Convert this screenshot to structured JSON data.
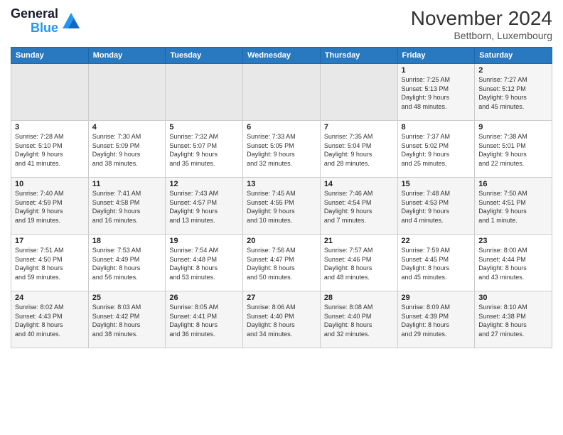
{
  "logo": {
    "line1": "General",
    "line2": "Blue"
  },
  "title": "November 2024",
  "location": "Bettborn, Luxembourg",
  "weekdays": [
    "Sunday",
    "Monday",
    "Tuesday",
    "Wednesday",
    "Thursday",
    "Friday",
    "Saturday"
  ],
  "weeks": [
    [
      {
        "day": "",
        "info": ""
      },
      {
        "day": "",
        "info": ""
      },
      {
        "day": "",
        "info": ""
      },
      {
        "day": "",
        "info": ""
      },
      {
        "day": "",
        "info": ""
      },
      {
        "day": "1",
        "info": "Sunrise: 7:25 AM\nSunset: 5:13 PM\nDaylight: 9 hours\nand 48 minutes."
      },
      {
        "day": "2",
        "info": "Sunrise: 7:27 AM\nSunset: 5:12 PM\nDaylight: 9 hours\nand 45 minutes."
      }
    ],
    [
      {
        "day": "3",
        "info": "Sunrise: 7:28 AM\nSunset: 5:10 PM\nDaylight: 9 hours\nand 41 minutes."
      },
      {
        "day": "4",
        "info": "Sunrise: 7:30 AM\nSunset: 5:09 PM\nDaylight: 9 hours\nand 38 minutes."
      },
      {
        "day": "5",
        "info": "Sunrise: 7:32 AM\nSunset: 5:07 PM\nDaylight: 9 hours\nand 35 minutes."
      },
      {
        "day": "6",
        "info": "Sunrise: 7:33 AM\nSunset: 5:05 PM\nDaylight: 9 hours\nand 32 minutes."
      },
      {
        "day": "7",
        "info": "Sunrise: 7:35 AM\nSunset: 5:04 PM\nDaylight: 9 hours\nand 28 minutes."
      },
      {
        "day": "8",
        "info": "Sunrise: 7:37 AM\nSunset: 5:02 PM\nDaylight: 9 hours\nand 25 minutes."
      },
      {
        "day": "9",
        "info": "Sunrise: 7:38 AM\nSunset: 5:01 PM\nDaylight: 9 hours\nand 22 minutes."
      }
    ],
    [
      {
        "day": "10",
        "info": "Sunrise: 7:40 AM\nSunset: 4:59 PM\nDaylight: 9 hours\nand 19 minutes."
      },
      {
        "day": "11",
        "info": "Sunrise: 7:41 AM\nSunset: 4:58 PM\nDaylight: 9 hours\nand 16 minutes."
      },
      {
        "day": "12",
        "info": "Sunrise: 7:43 AM\nSunset: 4:57 PM\nDaylight: 9 hours\nand 13 minutes."
      },
      {
        "day": "13",
        "info": "Sunrise: 7:45 AM\nSunset: 4:55 PM\nDaylight: 9 hours\nand 10 minutes."
      },
      {
        "day": "14",
        "info": "Sunrise: 7:46 AM\nSunset: 4:54 PM\nDaylight: 9 hours\nand 7 minutes."
      },
      {
        "day": "15",
        "info": "Sunrise: 7:48 AM\nSunset: 4:53 PM\nDaylight: 9 hours\nand 4 minutes."
      },
      {
        "day": "16",
        "info": "Sunrise: 7:50 AM\nSunset: 4:51 PM\nDaylight: 9 hours\nand 1 minute."
      }
    ],
    [
      {
        "day": "17",
        "info": "Sunrise: 7:51 AM\nSunset: 4:50 PM\nDaylight: 8 hours\nand 59 minutes."
      },
      {
        "day": "18",
        "info": "Sunrise: 7:53 AM\nSunset: 4:49 PM\nDaylight: 8 hours\nand 56 minutes."
      },
      {
        "day": "19",
        "info": "Sunrise: 7:54 AM\nSunset: 4:48 PM\nDaylight: 8 hours\nand 53 minutes."
      },
      {
        "day": "20",
        "info": "Sunrise: 7:56 AM\nSunset: 4:47 PM\nDaylight: 8 hours\nand 50 minutes."
      },
      {
        "day": "21",
        "info": "Sunrise: 7:57 AM\nSunset: 4:46 PM\nDaylight: 8 hours\nand 48 minutes."
      },
      {
        "day": "22",
        "info": "Sunrise: 7:59 AM\nSunset: 4:45 PM\nDaylight: 8 hours\nand 45 minutes."
      },
      {
        "day": "23",
        "info": "Sunrise: 8:00 AM\nSunset: 4:44 PM\nDaylight: 8 hours\nand 43 minutes."
      }
    ],
    [
      {
        "day": "24",
        "info": "Sunrise: 8:02 AM\nSunset: 4:43 PM\nDaylight: 8 hours\nand 40 minutes."
      },
      {
        "day": "25",
        "info": "Sunrise: 8:03 AM\nSunset: 4:42 PM\nDaylight: 8 hours\nand 38 minutes."
      },
      {
        "day": "26",
        "info": "Sunrise: 8:05 AM\nSunset: 4:41 PM\nDaylight: 8 hours\nand 36 minutes."
      },
      {
        "day": "27",
        "info": "Sunrise: 8:06 AM\nSunset: 4:40 PM\nDaylight: 8 hours\nand 34 minutes."
      },
      {
        "day": "28",
        "info": "Sunrise: 8:08 AM\nSunset: 4:40 PM\nDaylight: 8 hours\nand 32 minutes."
      },
      {
        "day": "29",
        "info": "Sunrise: 8:09 AM\nSunset: 4:39 PM\nDaylight: 8 hours\nand 29 minutes."
      },
      {
        "day": "30",
        "info": "Sunrise: 8:10 AM\nSunset: 4:38 PM\nDaylight: 8 hours\nand 27 minutes."
      }
    ]
  ]
}
